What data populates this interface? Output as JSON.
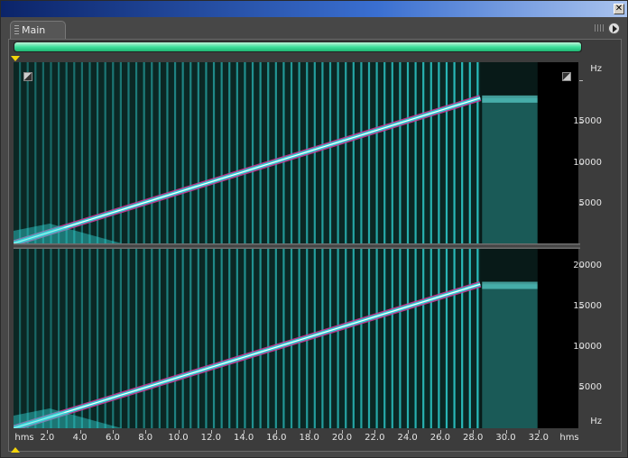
{
  "window": {
    "close_glyph": "✕"
  },
  "tab": {
    "label": "Main",
    "grip_icon": "grip-icon",
    "menu_icon": "play-menu-icon"
  },
  "progress": {
    "percent": 100,
    "color": "#40e09d"
  },
  "colors": {
    "spectrum_bg": "#081a18",
    "spectrum": "#30d8d8",
    "sweep_edge": "#d03a9a",
    "sweep_core": "#ffffff",
    "marker": "#f2d40a"
  },
  "top_ruler": {
    "unit": "Hz",
    "labels": [
      "15000",
      "10000",
      "5000"
    ]
  },
  "bottom_ruler": {
    "unit": "Hz",
    "labels": [
      "20000",
      "15000",
      "10000",
      "5000"
    ]
  },
  "time_ruler": {
    "unit_left": "hms",
    "unit_right": "hms",
    "labels": [
      "2.0",
      "4.0",
      "6.0",
      "8.0",
      "10.0",
      "12.0",
      "14.0",
      "16.0",
      "18.0",
      "20.0",
      "22.0",
      "24.0",
      "26.0",
      "28.0",
      "30.0",
      "32.0"
    ]
  },
  "signal": {
    "sweep_end_seconds": 28.5,
    "noise_end_seconds": 32.0,
    "sweep_end_hz": 17500,
    "pulse_count": 60
  }
}
